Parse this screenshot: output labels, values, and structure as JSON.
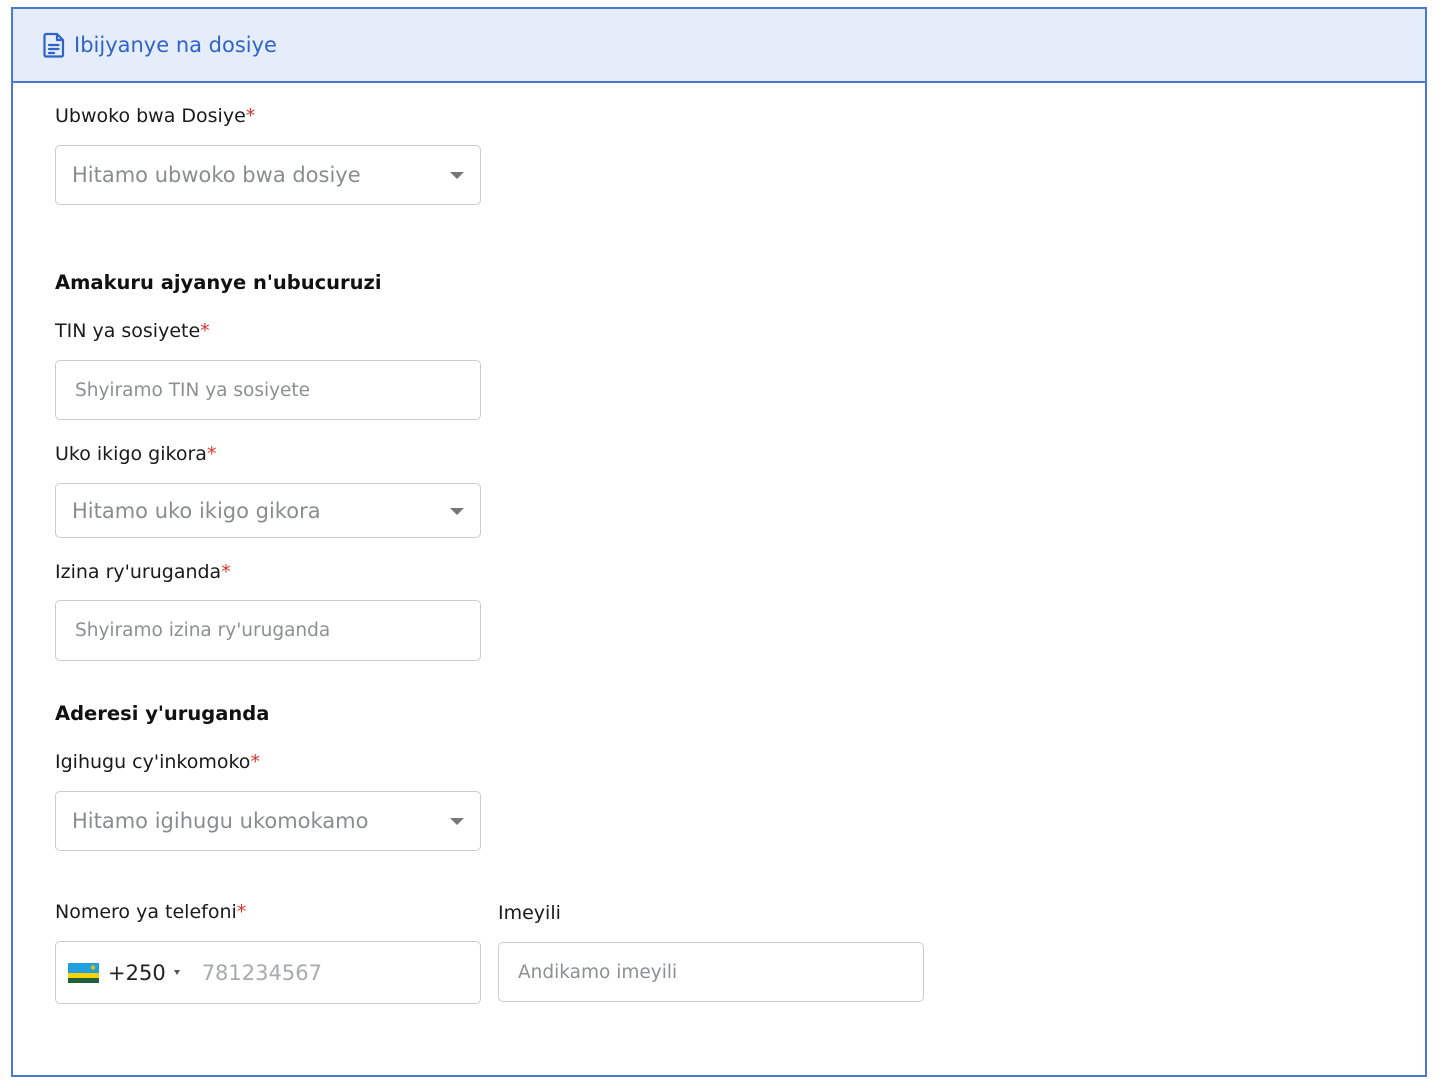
{
  "header": {
    "icon": "document-icon",
    "title": "Ibijyanye na dosiye"
  },
  "form": {
    "required_mark": "*",
    "file_type": {
      "label": "Ubwoko bwa Dosiye",
      "placeholder": "Hitamo ubwoko bwa dosiye"
    },
    "business_section": "Amakuru ajyanye n'ubucuruzi",
    "tin": {
      "label": "TIN ya sosiyete",
      "placeholder": "Shyiramo TIN ya sosiyete"
    },
    "company_type": {
      "label": "Uko ikigo gikora",
      "placeholder": "Hitamo uko ikigo gikora"
    },
    "factory_name": {
      "label": "Izina ry'uruganda",
      "placeholder": "Shyiramo izina ry'uruganda"
    },
    "address_section": "Aderesi y'uruganda",
    "country": {
      "label": "Igihugu cy'inkomoko",
      "placeholder": "Hitamo igihugu ukomokamo"
    },
    "phone": {
      "label": "Nomero ya telefoni",
      "country_code": "+250",
      "flag_icon": "rwanda-flag-icon",
      "placeholder": "781234567"
    },
    "email": {
      "label": "Imeyili",
      "placeholder": "Andikamo imeyili"
    }
  },
  "colors": {
    "accent": "#2f63c9",
    "border": "#4a78d4",
    "header_bg": "#e6edfa",
    "required": "#d9342b"
  }
}
